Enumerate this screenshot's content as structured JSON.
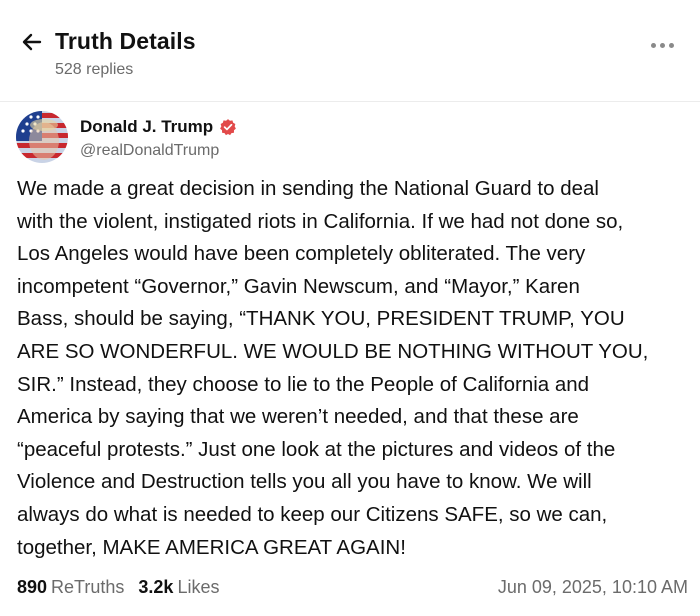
{
  "header": {
    "title": "Truth Details",
    "replies": "528 replies",
    "back_icon": "arrow-left-icon",
    "more_icon": "ellipsis-icon"
  },
  "author": {
    "name": "Donald J. Trump",
    "handle": "@realDonaldTrump",
    "verified_icon": "verified-badge-icon",
    "verified_color": "#e24a4a"
  },
  "post": {
    "text": "We made a great decision in sending the National Guard to deal\nwith the violent, instigated riots in California. If we had not done so,\nLos Angeles would have been completely obliterated. The very\nincompetent “Governor,”  Gavin Newscum, and “Mayor,” Karen\nBass, should be saying, “THANK YOU, PRESIDENT TRUMP, YOU\nARE SO WONDERFUL. WE WOULD BE NOTHING WITHOUT YOU,\nSIR.” Instead, they choose to lie to the People of California and\nAmerica by saying that we weren’t needed, and that these are\n“peaceful protests.” Just one look at the pictures and videos of the\nViolence and Destruction tells you all you have to know. We will\nalways do what is needed to keep our Citizens SAFE, so we can,\ntogether, MAKE AMERICA GREAT AGAIN!"
  },
  "stats": {
    "retruths_count": "890",
    "retruths_label": "ReTruths",
    "likes_count": "3.2k",
    "likes_label": "Likes",
    "timestamp": "Jun 09, 2025, 10:10 AM"
  }
}
